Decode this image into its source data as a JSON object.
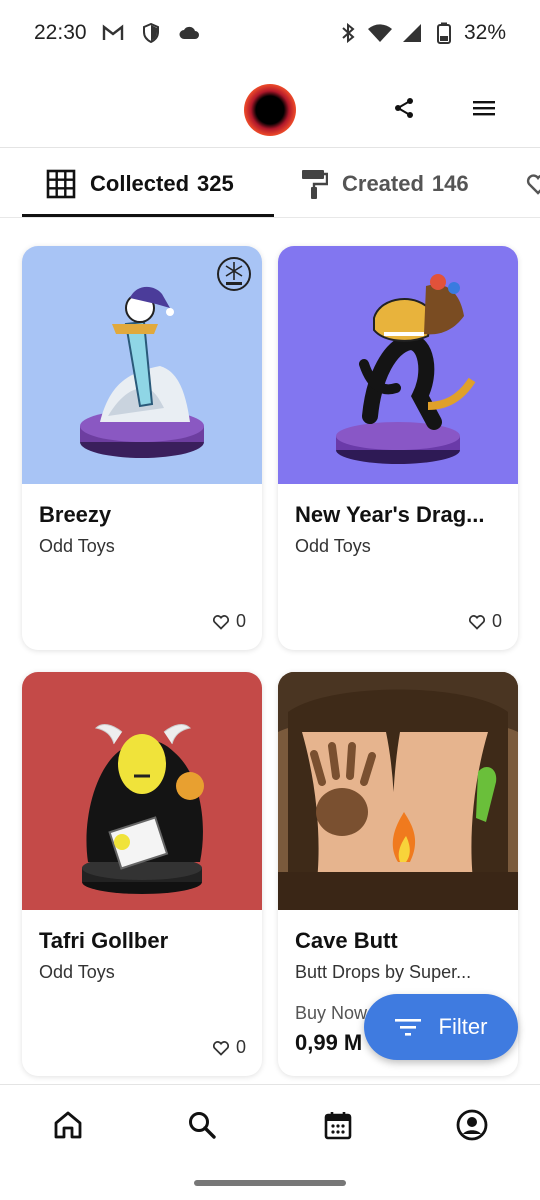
{
  "status_bar": {
    "time": "22:30",
    "battery": "32%",
    "icons_left": [
      "gmail-icon",
      "shield-icon",
      "cloud-icon"
    ],
    "icons_right": [
      "bluetooth-icon",
      "wifi-icon",
      "signal-icon",
      "battery-icon"
    ]
  },
  "header": {
    "share_icon": "share-icon",
    "menu_icon": "hamburger-menu-icon"
  },
  "tabs": [
    {
      "label": "Collected",
      "count": "325",
      "icon": "grid-icon",
      "selected": true
    },
    {
      "label": "Created",
      "count": "146",
      "icon": "paint-roller-icon",
      "selected": false
    }
  ],
  "items": [
    {
      "title": "Breezy",
      "subtitle": "Odd Toys",
      "likes": "0",
      "badge": "snowflake-badge-icon",
      "bg": "#a8c4f5"
    },
    {
      "title": "New Year's Drag...",
      "subtitle": "Odd Toys",
      "likes": "0",
      "bg": "#8276f0"
    },
    {
      "title": "Tafri Gollber",
      "subtitle": "Odd Toys",
      "likes": "0",
      "bg": "#c44a48"
    },
    {
      "title": "Cave Butt",
      "subtitle": "Butt Drops by Super...",
      "price_label": "Buy Now",
      "price": "0,99 M",
      "bg": "#6b4a32"
    }
  ],
  "fab": {
    "label": "Filter",
    "icon": "filter-icon"
  },
  "bottom_nav": [
    "home-icon",
    "search-icon",
    "calendar-icon",
    "profile-icon"
  ]
}
